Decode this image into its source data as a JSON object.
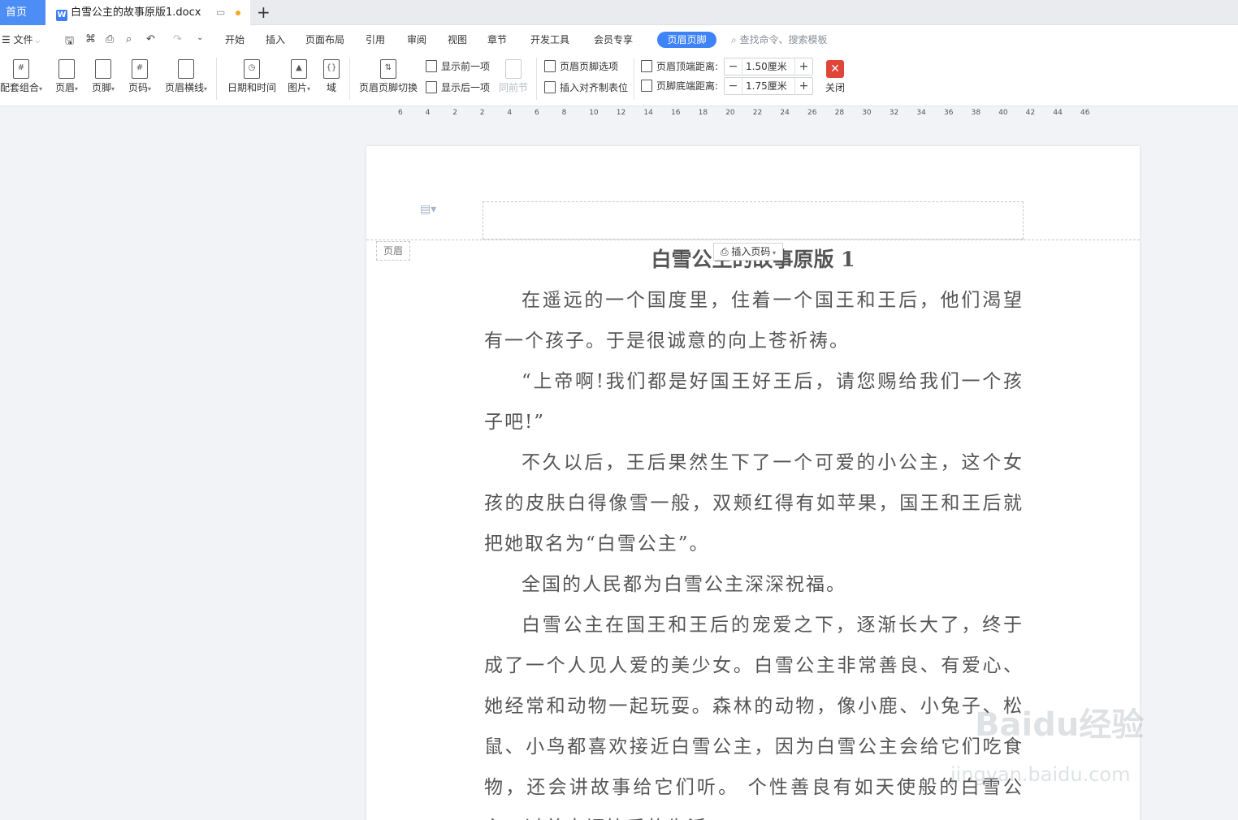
{
  "tabbar": {
    "home_label": "首页",
    "doc_title": "白雪公主的故事原版1.docx",
    "new_tab": "+"
  },
  "menu": {
    "file": "文件",
    "tabs": [
      "开始",
      "插入",
      "页面布局",
      "引用",
      "审阅",
      "视图",
      "章节",
      "开发工具",
      "会员专享"
    ],
    "active_tab": "页眉页脚",
    "search_placeholder": "查找命令、搜索模板"
  },
  "ribbon": {
    "btn_combo": "配套组合",
    "btn_header": "页眉",
    "btn_footer": "页脚",
    "btn_pageno": "页码",
    "btn_hline": "页眉横线",
    "btn_datetime": "日期和时间",
    "btn_picture": "图片",
    "btn_field": "域",
    "btn_switch": "页眉页脚切换",
    "show_prev": "显示前一项",
    "show_next": "显示后一项",
    "same_as_prev": "同前节",
    "hf_options": "页眉页脚选项",
    "insert_tab": "插入对齐制表位",
    "header_top_label": "页眉顶端距离:",
    "header_top_value": "1.50厘米",
    "footer_bottom_label": "页脚底端距离:",
    "footer_bottom_value": "1.75厘米",
    "close": "关闭"
  },
  "ruler": {
    "ticks": [
      "6",
      "4",
      "2",
      "2",
      "4",
      "6",
      "8",
      "10",
      "12",
      "14",
      "16",
      "18",
      "20",
      "22",
      "24",
      "26",
      "28",
      "30",
      "32",
      "34",
      "36",
      "38",
      "40",
      "42",
      "44",
      "46"
    ]
  },
  "doc": {
    "header_tag": "页眉",
    "insert_page_number": "插入页码",
    "title": "白雪公主的故事原版 1",
    "paragraphs": [
      "在遥远的一个国度里，住着一个国王和王后，他们渴望有一个孩子。于是很诚意的向上苍祈祷。",
      "“上帝啊!我们都是好国王好王后，请您赐给我们一个孩子吧!”",
      "不久以后，王后果然生下了一个可爱的小公主，这个女孩的皮肤白得像雪一般，双颊红得有如苹果，国王和王后就把她取名为“白雪公主”。",
      "全国的人民都为白雪公主深深祝福。",
      "白雪公主在国王和王后的宠爱之下，逐渐长大了，终于成了一个人见人爱的美少女。白雪公主非常善良、有爱心、她经常和动物一起玩耍。森林的动物，像小鹿、小兔子、松鼠、小鸟都喜欢接近白雪公主，因为白雪公主会给它们吃食物，还会讲故事给它们听。 个性善良有如天使般的白雪公主，过着幸福快乐的生活。"
    ]
  },
  "watermark": {
    "brand": "Baidu经验",
    "url": "jingyan.baidu.com"
  }
}
